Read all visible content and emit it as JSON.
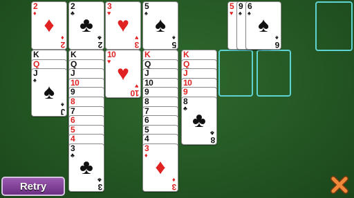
{
  "retry_label": "Retry",
  "colors": {
    "felt": "#2a5f2a",
    "slot_outline": "#5fd3d3",
    "red_suit": "#e02222",
    "black_suit": "#111111",
    "retry_bg": "#7a3d94",
    "close_icon": "#e8742a"
  },
  "top_row": [
    {
      "rank": "2",
      "suit": "♦",
      "color": "red"
    },
    {
      "rank": "2",
      "suit": "♣",
      "color": "black"
    },
    {
      "rank": "3",
      "suit": "♥",
      "color": "red"
    },
    {
      "rank": "5",
      "suit": "♠",
      "color": "black"
    }
  ],
  "foundation_stack": [
    {
      "rank": "5",
      "suit": "♥",
      "color": "red"
    },
    {
      "rank": "9",
      "suit": "♠",
      "color": "black"
    },
    {
      "rank": "6",
      "suit": "♠",
      "color": "black"
    }
  ],
  "columns": [
    {
      "name": "column-1",
      "hidden": [],
      "faceup": [
        {
          "rank": "K",
          "suit": "♠",
          "color": "black"
        },
        {
          "rank": "Q",
          "suit": "♥",
          "color": "red"
        },
        {
          "rank": "J",
          "suit": "♠",
          "color": "black"
        }
      ]
    },
    {
      "name": "column-2",
      "faceup": [
        {
          "rank": "K",
          "suit": "♣",
          "color": "black"
        },
        {
          "rank": "Q",
          "suit": "♣",
          "color": "black"
        },
        {
          "rank": "J",
          "suit": "♣",
          "color": "black"
        },
        {
          "rank": "10",
          "suit": "♥",
          "color": "red"
        },
        {
          "rank": "9",
          "suit": "♣",
          "color": "black"
        },
        {
          "rank": "8",
          "suit": "♥",
          "color": "red"
        },
        {
          "rank": "7",
          "suit": "♣",
          "color": "black"
        },
        {
          "rank": "6",
          "suit": "♥",
          "color": "red"
        },
        {
          "rank": "5",
          "suit": "♥",
          "color": "red"
        },
        {
          "rank": "4",
          "suit": "♥",
          "color": "red"
        },
        {
          "rank": "3",
          "suit": "♣",
          "color": "black"
        }
      ]
    },
    {
      "name": "column-3",
      "faceup": [
        {
          "rank": "10",
          "suit": "♥",
          "color": "red"
        }
      ]
    },
    {
      "name": "column-4",
      "faceup": [
        {
          "rank": "K",
          "suit": "♦",
          "color": "red"
        },
        {
          "rank": "Q",
          "suit": "♠",
          "color": "black"
        },
        {
          "rank": "J",
          "suit": "♠",
          "color": "black"
        },
        {
          "rank": "10",
          "suit": "♠",
          "color": "black"
        },
        {
          "rank": "9",
          "suit": "♠",
          "color": "black"
        },
        {
          "rank": "8",
          "suit": "♠",
          "color": "black"
        },
        {
          "rank": "7",
          "suit": "♠",
          "color": "black"
        },
        {
          "rank": "6",
          "suit": "♠",
          "color": "black"
        },
        {
          "rank": "5",
          "suit": "♠",
          "color": "black"
        },
        {
          "rank": "4",
          "suit": "♠",
          "color": "black"
        },
        {
          "rank": "3",
          "suit": "♦",
          "color": "red"
        }
      ]
    },
    {
      "name": "column-5",
      "faceup": [
        {
          "rank": "K",
          "suit": "♥",
          "color": "red"
        },
        {
          "rank": "Q",
          "suit": "♦",
          "color": "red"
        },
        {
          "rank": "J",
          "suit": "♦",
          "color": "red"
        },
        {
          "rank": "10",
          "suit": "♦",
          "color": "red"
        },
        {
          "rank": "9",
          "suit": "♦",
          "color": "red"
        },
        {
          "rank": "8",
          "suit": "♣",
          "color": "black"
        }
      ]
    }
  ]
}
